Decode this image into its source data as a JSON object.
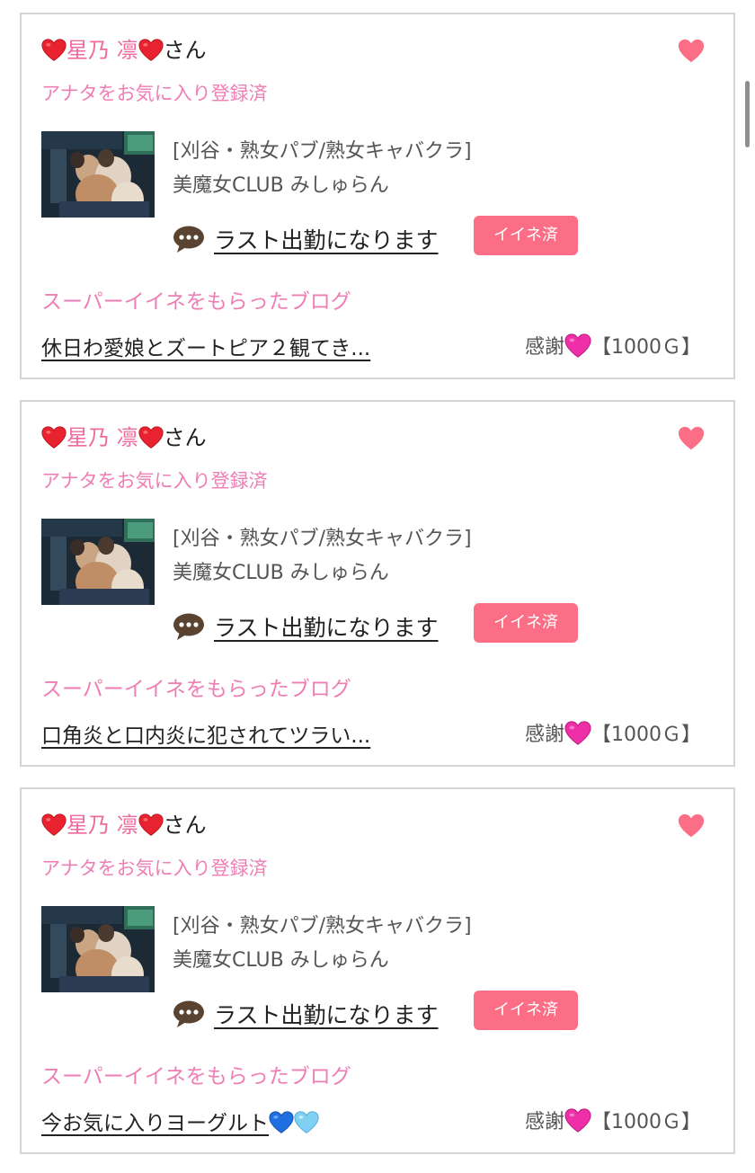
{
  "colors": {
    "pink_text": "#ee7eb4",
    "name_pink": "#ef6a9d",
    "badge_bg": "#fb6e86",
    "fav_heart": "#fb6e86",
    "border": "#d4d4d4"
  },
  "cards": [
    {
      "cast_name": "星乃 凛",
      "honorific": "さん",
      "name_emoji": "red-heart-emoji",
      "favorite_status": "アナタをお気に入り登録済",
      "favorite_icon": "heart-icon",
      "shop_category": "[刈谷・熟女パブ/熟女キャバクラ]",
      "shop_name": "美魔女CLUB みしゅらん",
      "message_icon": "speech-bubble-icon",
      "message": "ラスト出勤になります",
      "like_badge": "イイネ済",
      "super_like_label": "スーパーイイネをもらったブログ",
      "blog_title": "休日わ愛娘とズートピア２観てき...",
      "thanks_label": "感謝",
      "thanks_icon": "pink-heart-emoji",
      "thanks_amount": "【1000Ｇ】"
    },
    {
      "cast_name": "星乃 凛",
      "honorific": "さん",
      "name_emoji": "red-heart-emoji",
      "favorite_status": "アナタをお気に入り登録済",
      "favorite_icon": "heart-icon",
      "shop_category": "[刈谷・熟女パブ/熟女キャバクラ]",
      "shop_name": "美魔女CLUB みしゅらん",
      "message_icon": "speech-bubble-icon",
      "message": "ラスト出勤になります",
      "like_badge": "イイネ済",
      "super_like_label": "スーパーイイネをもらったブログ",
      "blog_title": "口角炎と口内炎に犯されてツラい...",
      "thanks_label": "感謝",
      "thanks_icon": "pink-heart-emoji",
      "thanks_amount": "【1000Ｇ】"
    },
    {
      "cast_name": "星乃 凛",
      "honorific": "さん",
      "name_emoji": "red-heart-emoji",
      "favorite_status": "アナタをお気に入り登録済",
      "favorite_icon": "heart-icon",
      "shop_category": "[刈谷・熟女パブ/熟女キャバクラ]",
      "shop_name": "美魔女CLUB みしゅらん",
      "message_icon": "speech-bubble-icon",
      "message": "ラスト出勤になります",
      "like_badge": "イイネ済",
      "super_like_label": "スーパーイイネをもらったブログ",
      "blog_title": "今お気に入りヨーグルト",
      "blog_title_emojis": [
        "blue-heart-emoji",
        "light-blue-heart-emoji"
      ],
      "thanks_label": "感謝",
      "thanks_icon": "pink-heart-emoji",
      "thanks_amount": "【1000Ｇ】"
    }
  ]
}
